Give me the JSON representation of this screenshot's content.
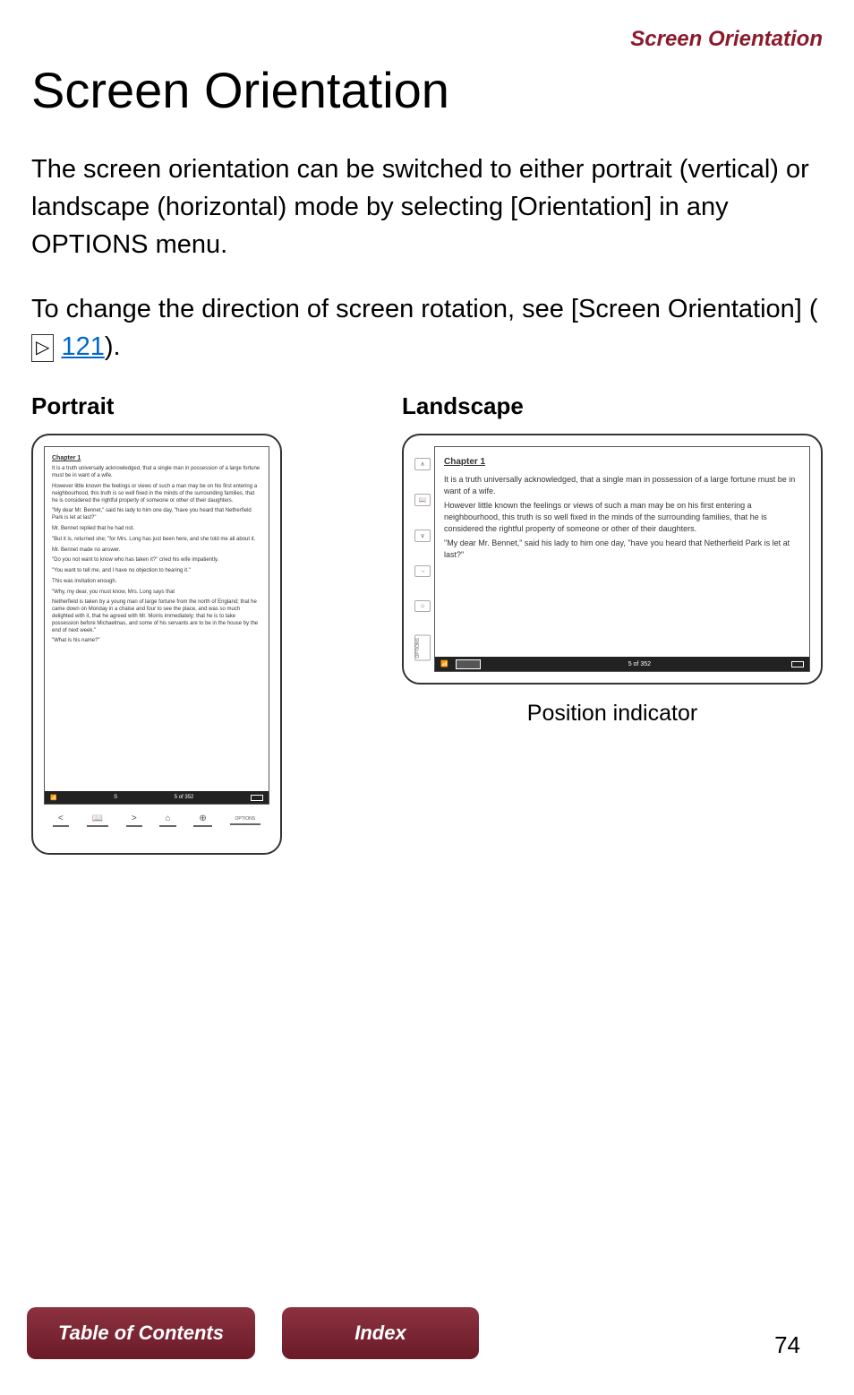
{
  "header": {
    "section_label": "Screen Orientation"
  },
  "title": "Screen Orientation",
  "paragraphs": {
    "p1": "The screen orientation can be switched to either portrait (vertical) or landscape (horizontal) mode by selecting [Orientation] in any OPTIONS menu.",
    "p2_pre": "To change the direction of screen rotation, see [Screen Orientation] (",
    "p2_link": "121",
    "p2_post": ")."
  },
  "columns": {
    "portrait_label": "Portrait",
    "landscape_label": "Landscape"
  },
  "sample_book": {
    "chapter": "Chapter 1",
    "lines": [
      "It is a truth universally acknowledged, that a single man in possession of a large fortune must be in want of a wife.",
      "However little known the feelings or views of such a man may be on his first entering a neighbourhood, this truth is so well fixed in the minds of the surrounding families, that he is considered the rightful property of someone or other of their daughters.",
      "\"My dear Mr. Bennet,\" said his lady to him one day, \"have you heard that Netherfield Park is let at last?\"",
      "Mr. Bennet replied that he had not.",
      "\"But it is, returned she; \"for Mrs. Long has just been here, and she told me all about it.",
      "Mr. Bennet made no answer.",
      "\"Do you not want to know who has taken it?\" cried his wife impatiently.",
      "\"You want to tell me, and I have no objection to hearing it.\"",
      "This was invitation enough.",
      "\"Why, my dear, you must know, Mrs. Long says that",
      "Netherfield is taken by a young man of large fortune from the north of England; that he came down on Monday in a chaise and four to see the place, and was so much delighted with it, that he agreed with Mr. Morris immediately; that he is to take possession before Michaelmas, and some of his servants are to be in the house by the end of next week.\"",
      "\"What is his name?\""
    ],
    "page_indicator": "5 of 352"
  },
  "landscape_caption": "Position indicator",
  "nav": {
    "toc": "Table of Contents",
    "index": "Index"
  },
  "page_number": "74",
  "portrait_buttons": {
    "prev": "<",
    "book": "📖",
    "next": ">",
    "home": "⌂",
    "zoom": "⊕",
    "options": "OPTIONS"
  },
  "status_icons": {
    "signal": "📶",
    "s": "S"
  },
  "side_buttons": {
    "up": "∧",
    "book": "📖",
    "down": "∨",
    "arrow": "→",
    "home": "⌂",
    "options": "OPTIONS"
  }
}
